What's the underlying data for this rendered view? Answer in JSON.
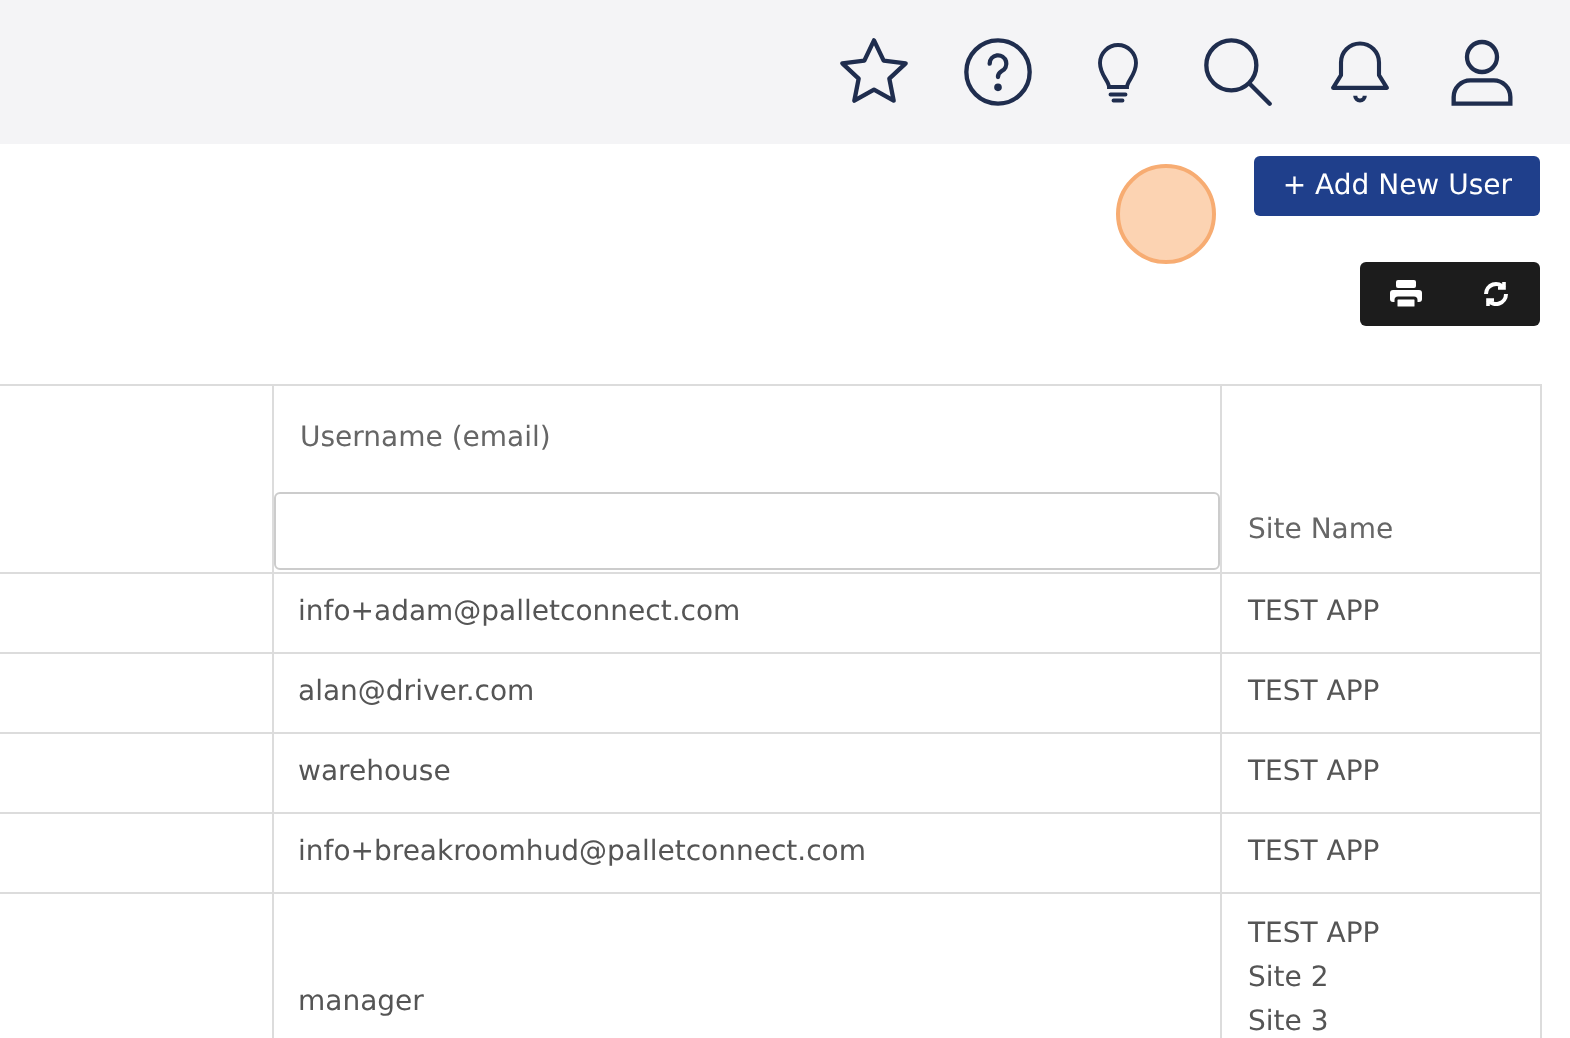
{
  "toolbar": {
    "add_button": "+ Add New User"
  },
  "table": {
    "columns": [
      {
        "kind": "filter",
        "label": "Username (email)"
      },
      {
        "kind": "plain",
        "label": "Site Name"
      }
    ],
    "rows": [
      {
        "username": "info+adam@palletconnect.com",
        "sites": [
          "TEST APP"
        ]
      },
      {
        "username": "alan@driver.com",
        "sites": [
          "TEST APP"
        ]
      },
      {
        "username": "warehouse",
        "sites": [
          "TEST APP"
        ]
      },
      {
        "username": "info+breakroomhud@palletconnect.com",
        "sites": [
          "TEST APP"
        ]
      },
      {
        "username": "manager",
        "sites": [
          "TEST APP",
          "Site 2",
          "Site 3"
        ]
      }
    ]
  }
}
